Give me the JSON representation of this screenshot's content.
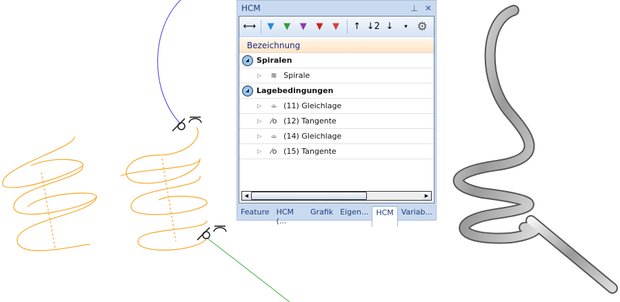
{
  "panel": {
    "title": "HCM",
    "pin_icon": "pin-icon",
    "close_icon": "close-icon",
    "toolbar": [
      "dimension-icon",
      "filter-blue-icon",
      "filter-play-icon",
      "filter-image-icon",
      "filter-warning-icon",
      "filter-stop-icon",
      "sort-up-icon",
      "sort-number-icon",
      "sort-down-icon",
      "overflow-icon",
      "gear-icon"
    ],
    "header": "Bezeichnung",
    "groups": [
      {
        "label": "Spiralen",
        "items": [
          {
            "label": "Spirale",
            "icon": "spiral-icon"
          }
        ]
      },
      {
        "label": "Lagebedingungen",
        "items": [
          {
            "label": "(11) Gleichlage",
            "icon": "coincident-icon"
          },
          {
            "label": "(12) Tangente",
            "icon": "tangent-icon"
          },
          {
            "label": "(14) Gleichlage",
            "icon": "coincident-icon"
          },
          {
            "label": "(15) Tangente",
            "icon": "tangent-icon"
          }
        ]
      }
    ],
    "tabs": [
      "Feature",
      "HCM (...",
      "Grafik",
      "Eigen...",
      "HCM",
      "Variab..."
    ],
    "active_tab": "HCM"
  },
  "colors": {
    "helix": "#f5a623",
    "blue_line": "#3a3adf",
    "green_line": "#3fa93f"
  }
}
